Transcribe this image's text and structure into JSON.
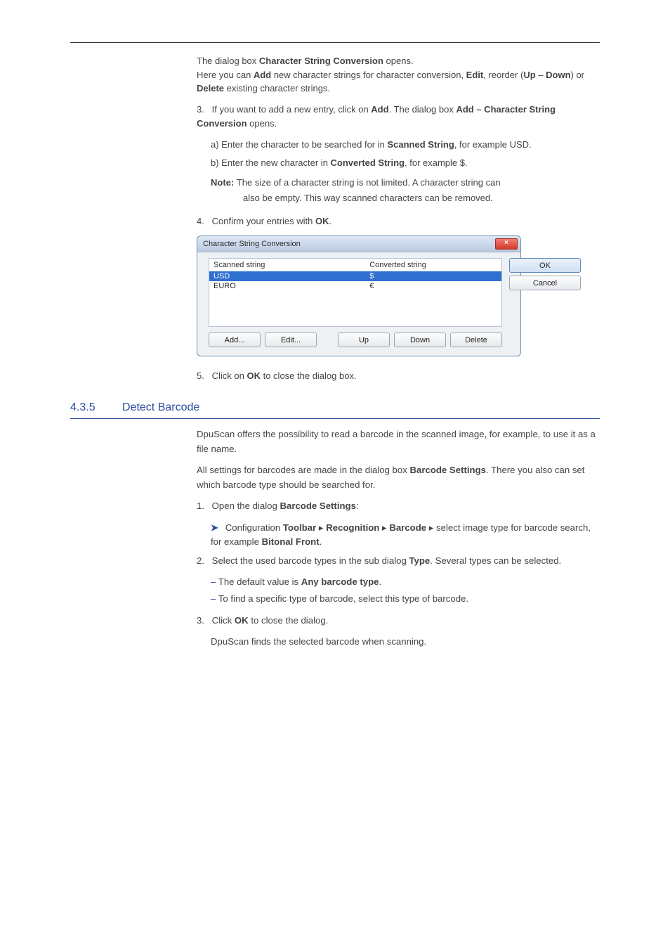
{
  "intro": {
    "line1_prefix": "The dialog box ",
    "line1_bold": "Character String Conversion",
    "line1_suffix": " opens.",
    "line2_pre": "Here you can ",
    "line2_b1": "Add",
    "line2_mid1": " new character strings for character conversion, ",
    "line2_b2": "Edit",
    "line2_mid2": ", reorder (",
    "line2_b3": "Up",
    "line2_dash": " – ",
    "line2_b4": "Down",
    "line2_mid3": ") or ",
    "line2_b5": "Delete",
    "line2_end": " existing character strings."
  },
  "list1": {
    "n": "3.",
    "text_pre": "If you want to add a new entry, click on ",
    "text_b": "Add",
    "text_post": ". The dialog box ",
    "text_b2": "Add – Character String Conversion",
    "text_end": " opens.",
    "sub_a_pre": "a) Enter the character to be searched for in ",
    "sub_a_b": "Scanned String",
    "sub_a_end": ", for example USD.",
    "sub_b_pre": "b) Enter the new character in ",
    "sub_b_b": "Converted String",
    "sub_b_end": ", for example $.",
    "note_label": "Note: ",
    "note_body": "The size of a character string is not limited. A character string can",
    "note_body2": "also be empty. This way scanned characters can be removed."
  },
  "list2": {
    "n": "4.",
    "text": "Confirm your entries with ",
    "text_b": "OK",
    "text_end": "."
  },
  "dialog": {
    "title": "Character String Conversion",
    "col_scanned": "Scanned string",
    "col_converted": "Converted string",
    "rows": [
      {
        "a": "USD",
        "b": "$"
      },
      {
        "a": "EURO",
        "b": "€"
      }
    ],
    "btns": {
      "add": "Add...",
      "edit": "Edit...",
      "up": "Up",
      "down": "Down",
      "del": "Delete"
    },
    "ok": "OK",
    "cancel": "Cancel",
    "close_glyph": "×"
  },
  "list3": {
    "n": "5.",
    "text": "Click on ",
    "text_b": "OK",
    "text_end": " to close the dialog box."
  },
  "sec": {
    "num": "4.3.5",
    "title": "Detect Barcode"
  },
  "p1": "DpuScan offers the possibility to read a barcode in the scanned image, for example, to use it as a file name.",
  "p2_pre": "All settings for barcodes are made in the dialog box ",
  "p2_b": "Barcode Settings",
  "p2_post": ". There you also can set which barcode type should be searched for.",
  "step1": {
    "n": "1.",
    "pre": "Open the dialog ",
    "b": "Barcode Settings",
    "end": ":",
    "arrow": "➤",
    "sub_pre": "Configuration ",
    "sub_b1": "Toolbar",
    "sub_mid": " ▸ ",
    "sub_b2": "Recognition",
    "sub_mid2": " ▸ ",
    "sub_b3": "Barcode",
    "sub_end": " ▸ select image type for barcode search, for example ",
    "sub_b4": "Bitonal Front",
    "sub_dot": "."
  },
  "step2": {
    "n": "2.",
    "pre": "Select the used barcode types in the sub dialog ",
    "b": "Type",
    "end": ". Several types can be selected.",
    "bul1_pre": "The default value is ",
    "bul1_b": "Any barcode type",
    "bul1_end": ".",
    "bul2": "To find a specific type of barcode, select this type of barcode."
  },
  "step3": {
    "n": "3.",
    "pre": "Click ",
    "b": "OK",
    "end": " to close the dialog.",
    "tail": "DpuScan finds the selected barcode when scanning."
  }
}
